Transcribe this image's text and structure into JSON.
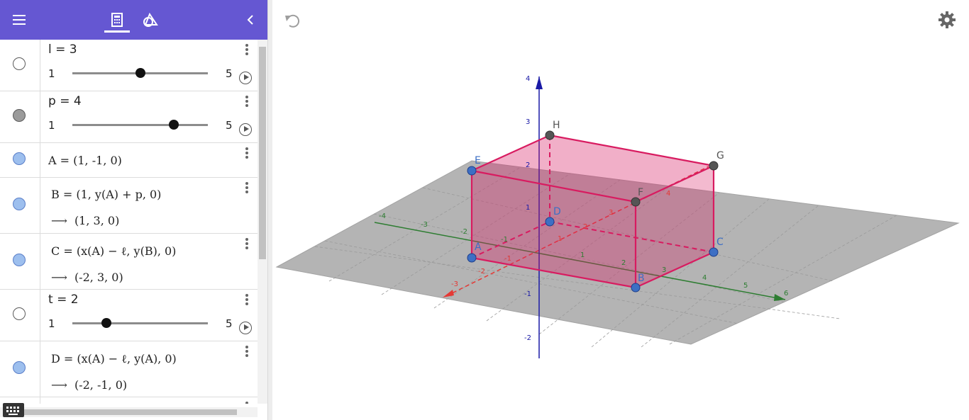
{
  "toolbar": {
    "menu_icon": "hamburger-menu-icon",
    "algebra_tab_icon": "calculator-icon",
    "tools_tab_icon": "geometry-tools-icon",
    "collapse_icon": "chevron-left-icon"
  },
  "algebra": {
    "sliders": [
      {
        "label": "l = 3",
        "min": "1",
        "max": "5",
        "value": 3
      },
      {
        "label": "p = 4",
        "min": "1",
        "max": "5",
        "value": 4
      },
      {
        "label": "t = 2",
        "min": "1",
        "max": "5",
        "value": 2
      }
    ],
    "items": [
      {
        "definition": "A = (1, -1, 0)",
        "value": ""
      },
      {
        "definition": "B = (1, y(A) + p, 0)",
        "value": "(1, 3, 0)"
      },
      {
        "definition": "C = (x(A) − ℓ, y(B), 0)",
        "value": "(-2, 3, 0)"
      },
      {
        "definition": "D = (x(A) − ℓ, y(A), 0)",
        "value": "(-2, -1, 0)"
      }
    ]
  },
  "graphics": {
    "undo_icon": "undo-icon",
    "settings_icon": "gear-icon",
    "point_labels": [
      "A",
      "B",
      "C",
      "D",
      "E",
      "F",
      "G",
      "H"
    ],
    "z_ticks": [
      "4",
      "3",
      "2",
      "1",
      "-1",
      "-2"
    ],
    "y_ticks": [
      "-4",
      "-3",
      "-2",
      "-1",
      "1",
      "2",
      "3",
      "4",
      "5",
      "6"
    ],
    "x_ticks": [
      "-3",
      "-2",
      "-1",
      "1",
      "2",
      "3",
      "4"
    ],
    "colors": {
      "prism": "#d81b60",
      "x_axis": "#e53935",
      "y_axis": "#2e7d32",
      "z_axis": "#1a1aa6",
      "plane": "#b3b3b3"
    }
  }
}
